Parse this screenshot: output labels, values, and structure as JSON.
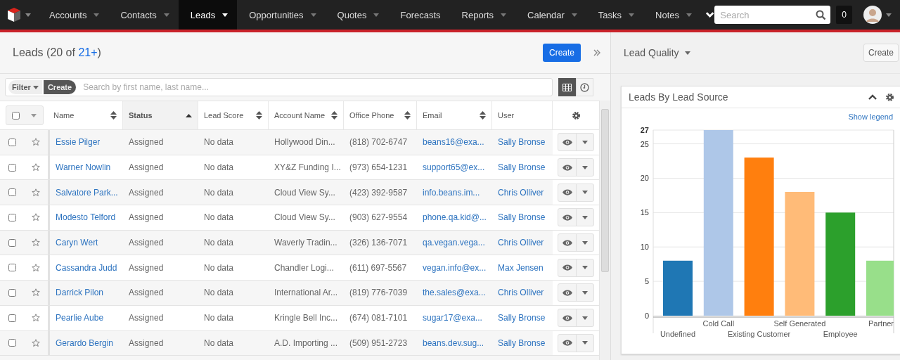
{
  "nav": {
    "items": [
      {
        "label": "Accounts",
        "selected": false,
        "dropdown": true
      },
      {
        "label": "Contacts",
        "selected": false,
        "dropdown": true
      },
      {
        "label": "Leads",
        "selected": true,
        "dropdown": true
      },
      {
        "label": "Opportunities",
        "selected": false,
        "dropdown": true
      },
      {
        "label": "Quotes",
        "selected": false,
        "dropdown": true
      },
      {
        "label": "Forecasts",
        "selected": false,
        "dropdown": false
      },
      {
        "label": "Reports",
        "selected": false,
        "dropdown": true
      },
      {
        "label": "Calendar",
        "selected": false,
        "dropdown": true
      },
      {
        "label": "Tasks",
        "selected": false,
        "dropdown": true
      },
      {
        "label": "Notes",
        "selected": false,
        "dropdown": true
      }
    ],
    "search": {
      "placeholder": "Search"
    },
    "notifications": "0"
  },
  "list": {
    "title": "Leads",
    "count_prefix": "(20 of ",
    "count_link": "21+",
    "count_suffix": ")",
    "create": "Create",
    "filter": {
      "label": "Filter",
      "create": "Create",
      "placeholder": "Search by first name, last name..."
    },
    "views": [
      {
        "kind": "list",
        "selected": true
      },
      {
        "kind": "activity",
        "selected": false
      }
    ],
    "select_all": {
      "checked": false
    },
    "columns": [
      {
        "label": "Name",
        "sortable": true,
        "sorted_ascending": false
      },
      {
        "label": "Status",
        "sortable": true,
        "sorted_ascending": true
      },
      {
        "label": "Lead Score",
        "sortable": true,
        "sorted_ascending": false
      },
      {
        "label": "Account Name",
        "sortable": true,
        "sorted_ascending": false
      },
      {
        "label": "Office Phone",
        "sortable": true,
        "sorted_ascending": false
      },
      {
        "label": "Email",
        "sortable": true,
        "sorted_ascending": false
      },
      {
        "label": "User",
        "sortable": false,
        "sorted_ascending": false
      }
    ],
    "rows": [
      {
        "checked": false,
        "favorite": false,
        "cells": [
          "Essie Pilger",
          "Assigned",
          "No data",
          "Hollywood Din...",
          "(818) 702-6747",
          "beans16@exa...",
          "Sally Bronse"
        ]
      },
      {
        "checked": false,
        "favorite": false,
        "cells": [
          "Warner Nowlin",
          "Assigned",
          "No data",
          "XY&Z Funding I...",
          "(973) 654-1231",
          "support65@ex...",
          "Sally Bronse"
        ]
      },
      {
        "checked": false,
        "favorite": false,
        "cells": [
          "Salvatore Park...",
          "Assigned",
          "No data",
          "Cloud View Sy...",
          "(423) 392-9587",
          "info.beans.im...",
          "Chris Olliver"
        ]
      },
      {
        "checked": false,
        "favorite": false,
        "cells": [
          "Modesto Telford",
          "Assigned",
          "No data",
          "Cloud View Sy...",
          "(903) 627-9554",
          "phone.qa.kid@...",
          "Sally Bronse"
        ]
      },
      {
        "checked": false,
        "favorite": false,
        "cells": [
          "Caryn Wert",
          "Assigned",
          "No data",
          "Waverly Tradin...",
          "(326) 136-7071",
          "qa.vegan.vega...",
          "Chris Olliver"
        ]
      },
      {
        "checked": false,
        "favorite": false,
        "cells": [
          "Cassandra Judd",
          "Assigned",
          "No data",
          "Chandler Logi...",
          "(611) 697-5567",
          "vegan.info@ex...",
          "Max Jensen"
        ]
      },
      {
        "checked": false,
        "favorite": false,
        "cells": [
          "Darrick Pilon",
          "Assigned",
          "No data",
          "International Ar...",
          "(819) 776-7039",
          "the.sales@exa...",
          "Chris Olliver"
        ]
      },
      {
        "checked": false,
        "favorite": false,
        "cells": [
          "Pearlie Aube",
          "Assigned",
          "No data",
          "Kringle Bell Inc...",
          "(674) 081-7101",
          "sugar17@exa...",
          "Sally Bronse"
        ]
      },
      {
        "checked": false,
        "favorite": false,
        "cells": [
          "Gerardo Bergin",
          "Assigned",
          "No data",
          "A.D. Importing ...",
          "(509) 951-2723",
          "beans.dev.sug...",
          "Sally Bronse"
        ]
      }
    ]
  },
  "sidebar": {
    "title": "Lead Quality",
    "create": "Create",
    "dashlet": {
      "title": "Leads By Lead Source",
      "legend_link": "Show legend",
      "chart_data": {
        "type": "bar",
        "categories": [
          "Undefined",
          "Cold Call",
          "Existing Customer",
          "Self Generated",
          "Employee",
          "Partner"
        ],
        "series": [
          {
            "color": "#1f77b4",
            "values": [
              8,
              null,
              null,
              null,
              null,
              null
            ]
          },
          {
            "color": "#aec7e8",
            "values": [
              null,
              27,
              null,
              null,
              null,
              null
            ]
          },
          {
            "color": "#ff7f0e",
            "values": [
              null,
              null,
              23,
              null,
              null,
              null
            ]
          },
          {
            "color": "#ffbb78",
            "values": [
              null,
              null,
              null,
              18,
              null,
              null
            ]
          },
          {
            "color": "#2ca02c",
            "values": [
              null,
              null,
              null,
              null,
              15,
              null
            ]
          },
          {
            "color": "#98df8a",
            "values": [
              null,
              null,
              null,
              null,
              null,
              8
            ]
          }
        ],
        "stacked": true,
        "grid": true,
        "ylim": [
          0,
          27
        ],
        "yticks": [
          0,
          5,
          10,
          15,
          20,
          25,
          27
        ]
      }
    }
  }
}
